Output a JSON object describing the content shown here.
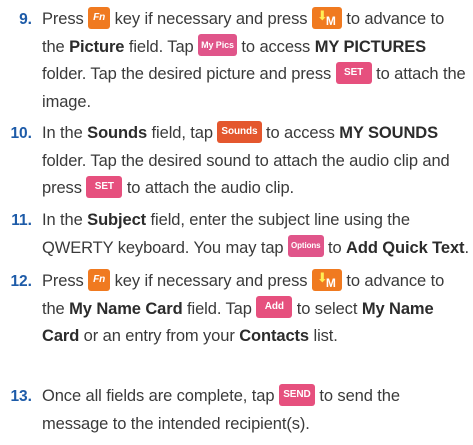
{
  "steps": [
    {
      "num": "9.",
      "t1": "Press ",
      "fn_key": "Fn",
      "t2": " key if necessary and press ",
      "down_key_label": "M",
      "t3": " to advance to the ",
      "b1": "Picture",
      "t4": " field. Tap ",
      "mypics_btn": "My Pics",
      "t5": " to access ",
      "b2": "MY PICTURES",
      "t6": " folder. Tap the desired picture and press ",
      "set_btn": "SET",
      "t7": " to attach the image."
    },
    {
      "num": "10.",
      "t1": "In the ",
      "b1": "Sounds",
      "t2": " field, tap ",
      "sounds_btn": "Sounds",
      "t3": " to access ",
      "b2": "MY SOUNDS",
      "t4": " folder. Tap the desired sound to attach the audio clip and press ",
      "set_btn": "SET",
      "t5": " to attach the audio clip."
    },
    {
      "num": "11.",
      "t1": "In the ",
      "b1": "Subject",
      "t2": " field, enter the subject line using the QWERTY keyboard. You may tap ",
      "options_btn": "Options",
      "t3": " to ",
      "b2": "Add Quick Text",
      "t4": "."
    },
    {
      "num": "12.",
      "t1": "Press ",
      "fn_key": "Fn",
      "t2": " key if necessary and press ",
      "down_key_label": "M",
      "t3": " to advance to the ",
      "b1": "My Name Card",
      "t4": " field. Tap ",
      "add_btn": "Add",
      "t5": " to select ",
      "b2": "My Name Card",
      "t6": " or an entry from your ",
      "b3": "Contacts",
      "t7": " list."
    },
    {
      "num": "13.",
      "t1": "Once all fields are complete, tap ",
      "send_btn": "SEND",
      "t2": " to send the message to the intended recipient(s)."
    }
  ],
  "colors": {
    "step_number": "#1d5ba8",
    "key_orange": "#f07a20",
    "button_pink": "#e0558a",
    "button_red": "#e4572e"
  },
  "icons": {
    "fn_key": "fn-key-icon",
    "down_key": "down-navigation-key-icon"
  }
}
